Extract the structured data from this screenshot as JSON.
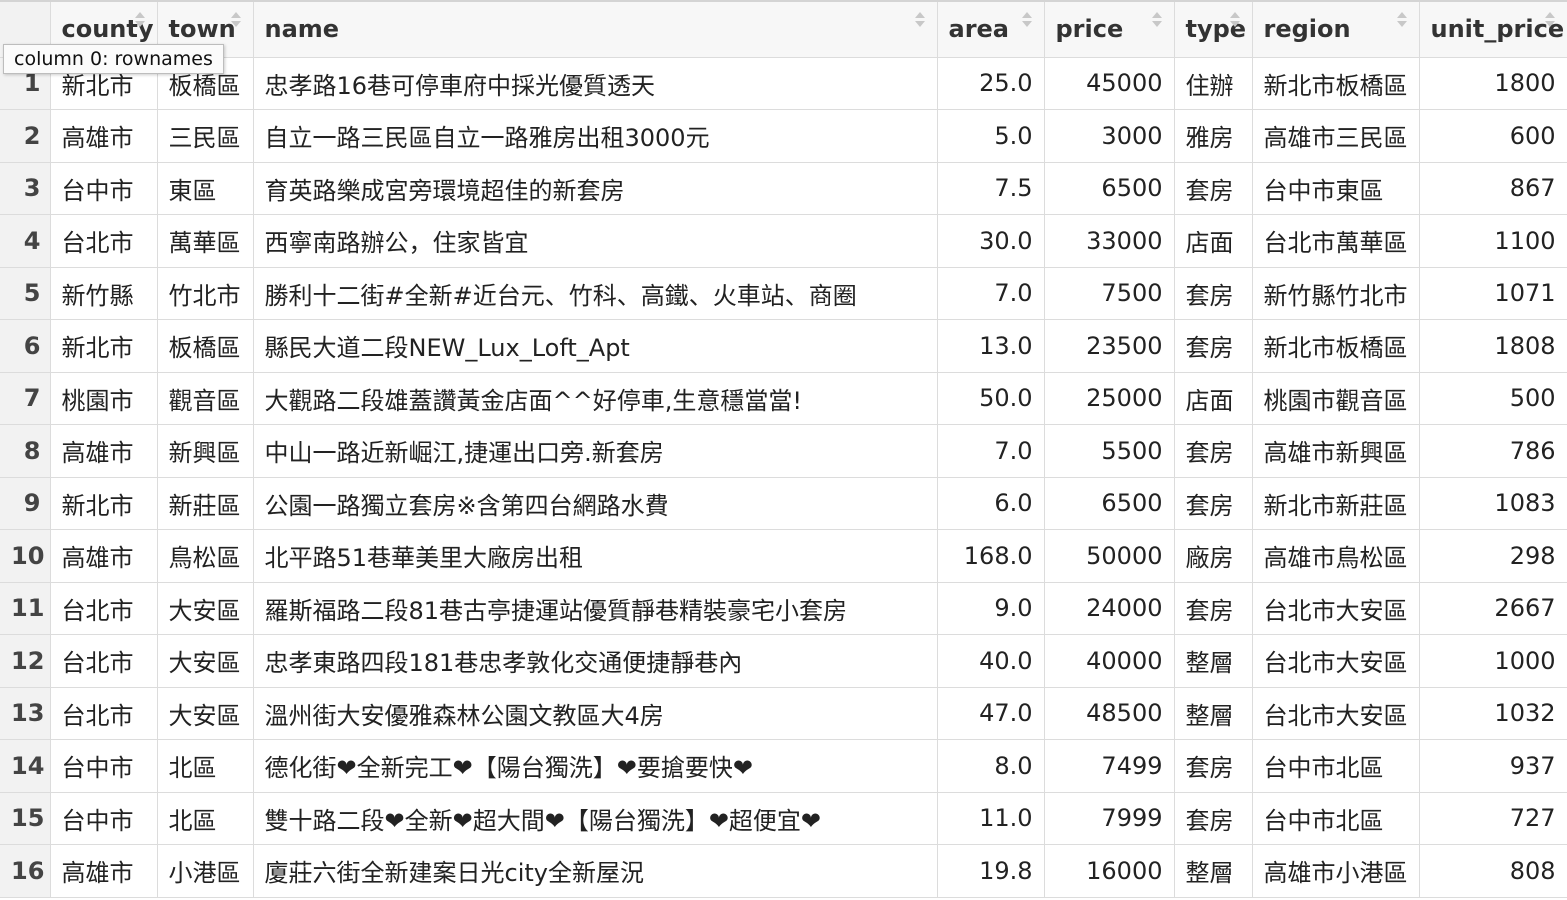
{
  "tooltip": "column 0: rownames",
  "columns": [
    {
      "key": "county",
      "label": "county"
    },
    {
      "key": "town",
      "label": "town"
    },
    {
      "key": "name",
      "label": "name"
    },
    {
      "key": "area",
      "label": "area"
    },
    {
      "key": "price",
      "label": "price"
    },
    {
      "key": "type",
      "label": "type"
    },
    {
      "key": "region",
      "label": "region"
    },
    {
      "key": "unit_price",
      "label": "unit_price"
    }
  ],
  "rows": [
    {
      "rowname": "1",
      "county": "新北市",
      "town": "板橋區",
      "name": "忠孝路16巷可停車府中採光優質透天",
      "area": "25.0",
      "price": "45000",
      "type": "住辦",
      "region": "新北市板橋區",
      "unit_price": "1800"
    },
    {
      "rowname": "2",
      "county": "高雄市",
      "town": "三民區",
      "name": "自立一路三民區自立一路雅房出租3000元",
      "area": "5.0",
      "price": "3000",
      "type": "雅房",
      "region": "高雄市三民區",
      "unit_price": "600"
    },
    {
      "rowname": "3",
      "county": "台中市",
      "town": "東區",
      "name": "育英路樂成宮旁環境超佳的新套房",
      "area": "7.5",
      "price": "6500",
      "type": "套房",
      "region": "台中市東區",
      "unit_price": "867"
    },
    {
      "rowname": "4",
      "county": "台北市",
      "town": "萬華區",
      "name": "西寧南路辦公，住家皆宜",
      "area": "30.0",
      "price": "33000",
      "type": "店面",
      "region": "台北市萬華區",
      "unit_price": "1100"
    },
    {
      "rowname": "5",
      "county": "新竹縣",
      "town": "竹北市",
      "name": "勝利十二街#全新#近台元、竹科、高鐵、火車站、商圈",
      "area": "7.0",
      "price": "7500",
      "type": "套房",
      "region": "新竹縣竹北市",
      "unit_price": "1071"
    },
    {
      "rowname": "6",
      "county": "新北市",
      "town": "板橋區",
      "name": "縣民大道二段NEW_Lux_Loft_Apt",
      "area": "13.0",
      "price": "23500",
      "type": "套房",
      "region": "新北市板橋區",
      "unit_price": "1808"
    },
    {
      "rowname": "7",
      "county": "桃園市",
      "town": "觀音區",
      "name": "大觀路二段雄蓋讚黃金店面^^好停車,生意穩當當!",
      "area": "50.0",
      "price": "25000",
      "type": "店面",
      "region": "桃園市觀音區",
      "unit_price": "500"
    },
    {
      "rowname": "8",
      "county": "高雄市",
      "town": "新興區",
      "name": "中山一路近新崛江,捷運出口旁.新套房",
      "area": "7.0",
      "price": "5500",
      "type": "套房",
      "region": "高雄市新興區",
      "unit_price": "786"
    },
    {
      "rowname": "9",
      "county": "新北市",
      "town": "新莊區",
      "name": "公園一路獨立套房※含第四台網路水費",
      "area": "6.0",
      "price": "6500",
      "type": "套房",
      "region": "新北市新莊區",
      "unit_price": "1083"
    },
    {
      "rowname": "10",
      "county": "高雄市",
      "town": "鳥松區",
      "name": "北平路51巷華美里大廠房出租",
      "area": "168.0",
      "price": "50000",
      "type": "廠房",
      "region": "高雄市鳥松區",
      "unit_price": "298"
    },
    {
      "rowname": "11",
      "county": "台北市",
      "town": "大安區",
      "name": "羅斯福路二段81巷古亭捷運站優質靜巷精裝豪宅小套房",
      "area": "9.0",
      "price": "24000",
      "type": "套房",
      "region": "台北市大安區",
      "unit_price": "2667"
    },
    {
      "rowname": "12",
      "county": "台北市",
      "town": "大安區",
      "name": "忠孝東路四段181巷忠孝敦化交通便捷靜巷內",
      "area": "40.0",
      "price": "40000",
      "type": "整層",
      "region": "台北市大安區",
      "unit_price": "1000"
    },
    {
      "rowname": "13",
      "county": "台北市",
      "town": "大安區",
      "name": "溫州街大安優雅森林公園文教區大4房",
      "area": "47.0",
      "price": "48500",
      "type": "整層",
      "region": "台北市大安區",
      "unit_price": "1032"
    },
    {
      "rowname": "14",
      "county": "台中市",
      "town": "北區",
      "name": "德化街❤全新完工❤【陽台獨洗】❤要搶要快❤",
      "area": "8.0",
      "price": "7499",
      "type": "套房",
      "region": "台中市北區",
      "unit_price": "937"
    },
    {
      "rowname": "15",
      "county": "台中市",
      "town": "北區",
      "name": "雙十路二段❤全新❤超大間❤【陽台獨洗】❤超便宜❤",
      "area": "11.0",
      "price": "7999",
      "type": "套房",
      "region": "台中市北區",
      "unit_price": "727"
    },
    {
      "rowname": "16",
      "county": "高雄市",
      "town": "小港區",
      "name": "廈莊六街全新建案日光city全新屋況",
      "area": "19.8",
      "price": "16000",
      "type": "整層",
      "region": "高雄市小港區",
      "unit_price": "808"
    }
  ]
}
